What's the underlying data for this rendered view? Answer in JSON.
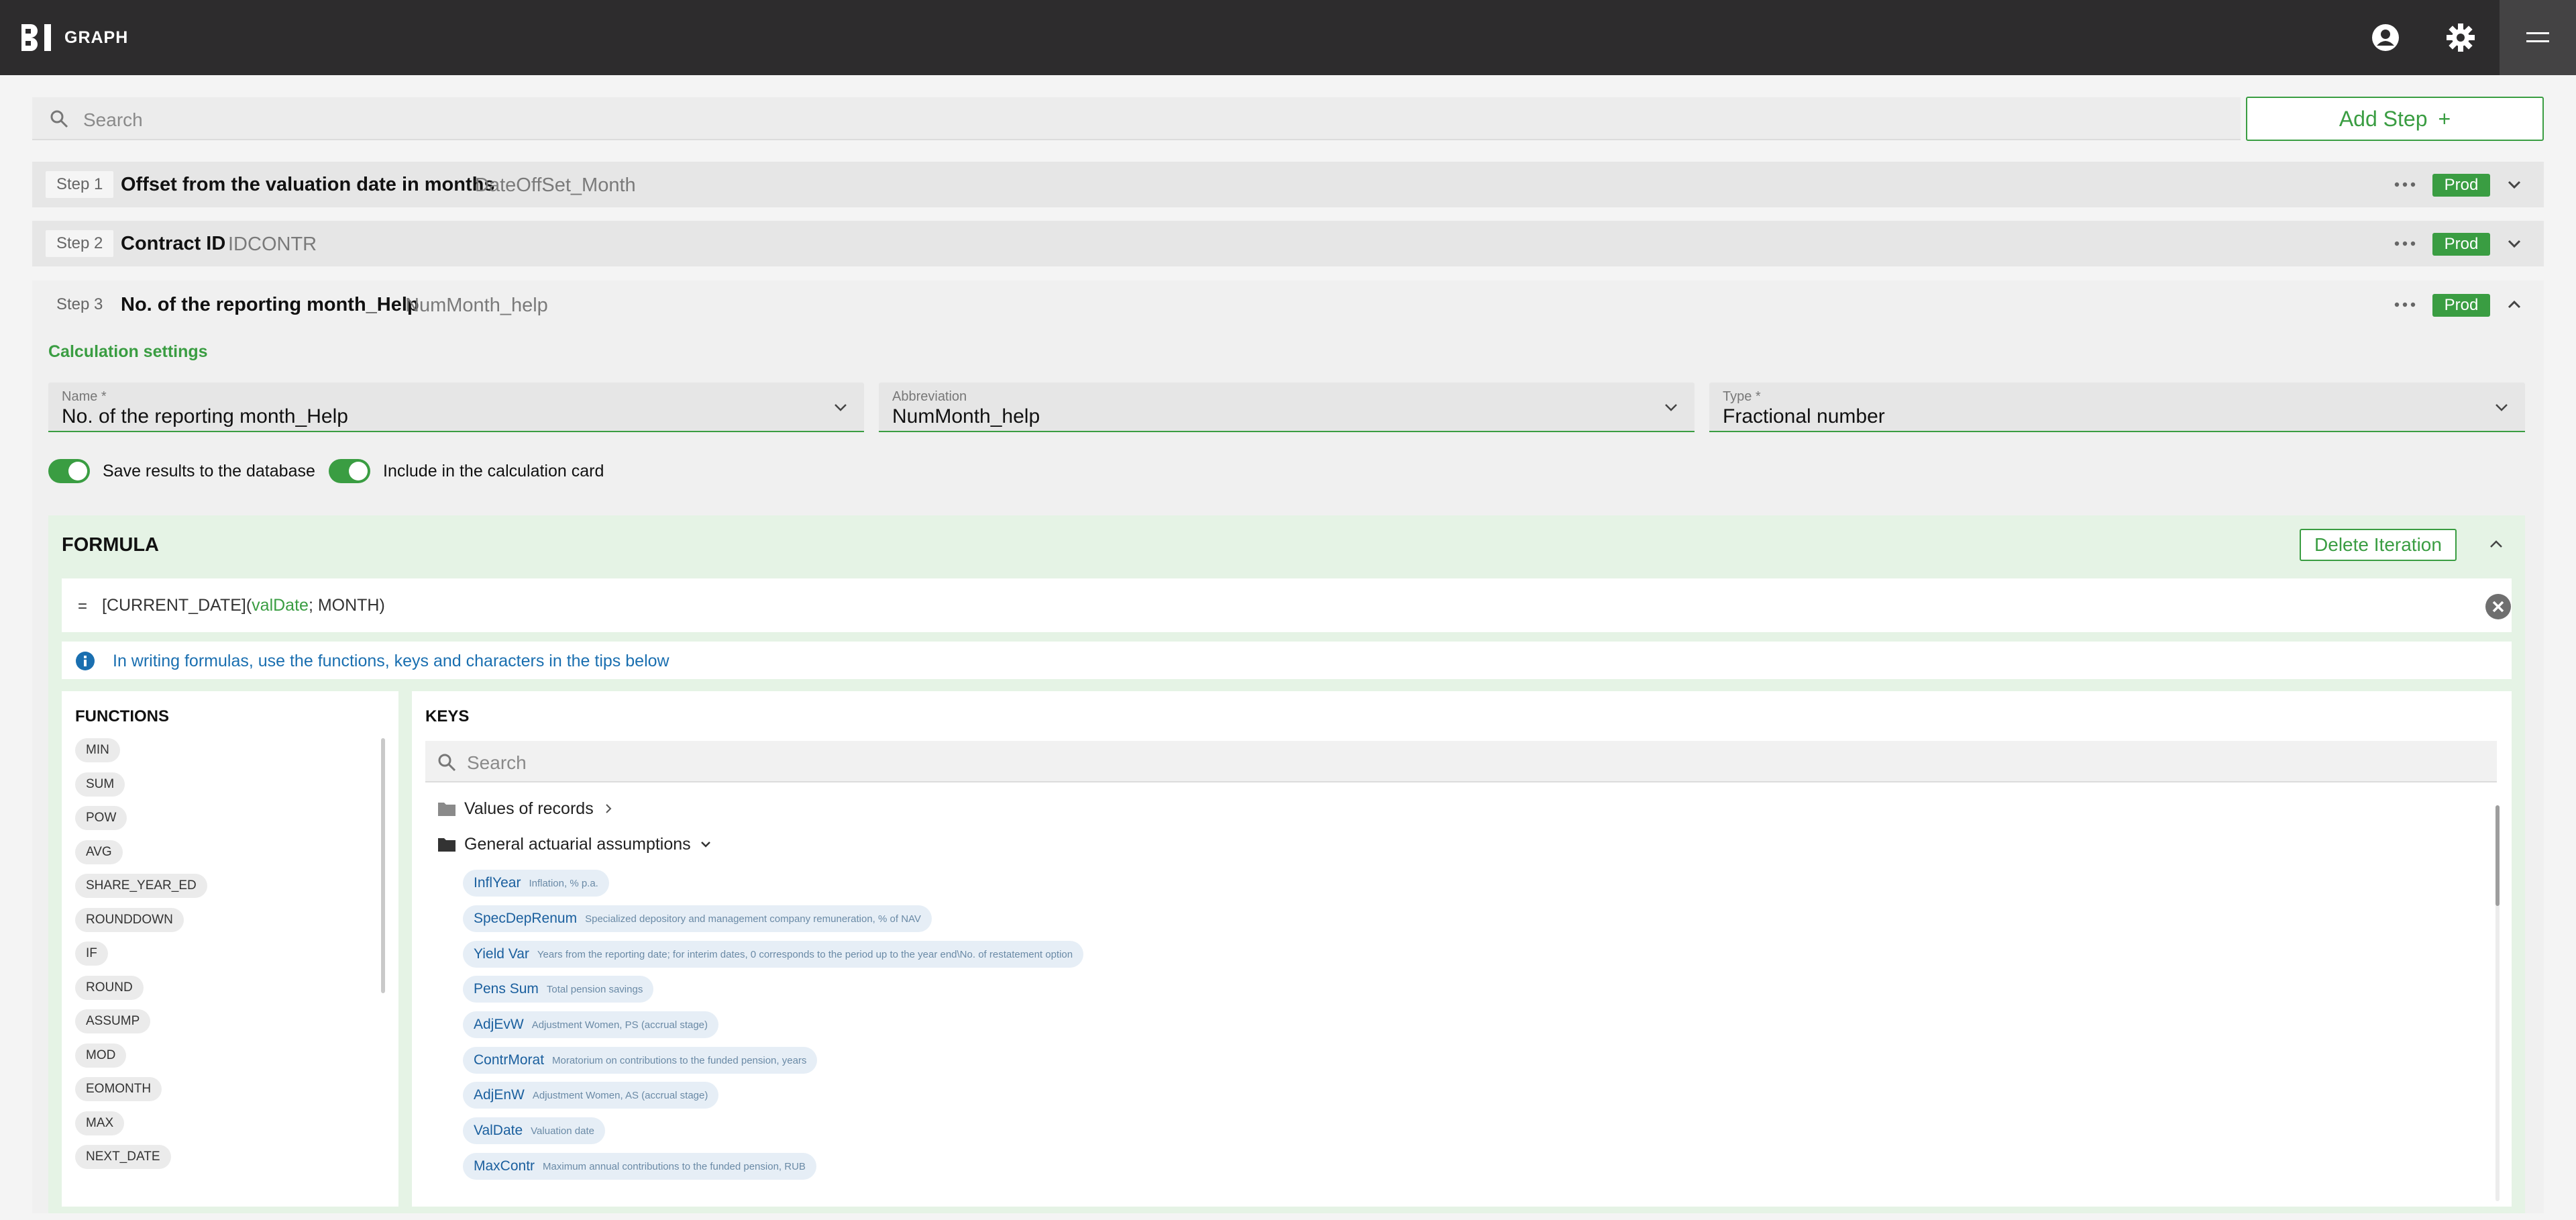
{
  "app": {
    "logo_text": "GRAPH",
    "logo_mark": "BI"
  },
  "header": {
    "icons": [
      "account-circle-icon",
      "settings-gear-icon",
      "menu-icon"
    ]
  },
  "search": {
    "placeholder": "Search"
  },
  "toolbar": {
    "add_step_label": "Add Step",
    "add_icon": "+"
  },
  "steps": [
    {
      "badge": "Step 1",
      "title": "Offset from the valuation date in months",
      "abbr": "DateOffSet_Month",
      "status": "Prod"
    },
    {
      "badge": "Step 2",
      "title": "Contract ID",
      "abbr": "IDCONTR",
      "status": "Prod"
    },
    {
      "badge": "Step 3",
      "title": "No. of the reporting month_Help",
      "abbr": "NumMonth_help",
      "status": "Prod"
    }
  ],
  "calc_settings": {
    "heading": "Calculation settings",
    "name_label": "Name *",
    "name_value": "No. of the reporting month_Help",
    "abbr_label": "Abbreviation",
    "abbr_value": "NumMonth_help",
    "type_label": "Type *",
    "type_value": "Fractional number",
    "toggle_save": "Save results to the database",
    "toggle_include": "Include in the calculation card"
  },
  "formula": {
    "title": "FORMULA",
    "delete_label": "Delete Iteration",
    "eq": "=",
    "text_prefix": "[CURRENT_DATE](",
    "text_arg": "valDate",
    "text_suffix": "; MONTH)",
    "info": "In writing formulas, use the functions, keys and characters in the tips below"
  },
  "functions": {
    "title": "FUNCTIONS",
    "items": [
      "MIN",
      "SUM",
      "POW",
      "AVG",
      "SHARE_YEAR_ED",
      "ROUNDDOWN",
      "IF",
      "ROUND",
      "ASSUMP",
      "MOD",
      "EOMONTH",
      "MAX",
      "NEXT_DATE"
    ]
  },
  "keys": {
    "title": "KEYS",
    "search_placeholder": "Search",
    "folders": [
      {
        "label": "Values of records",
        "state": "collapsed"
      },
      {
        "label": "General actuarial assumptions",
        "state": "expanded"
      }
    ],
    "items": [
      {
        "name": "InflYear",
        "desc": "Inflation, % p.a."
      },
      {
        "name": "SpecDepRenum",
        "desc": "Specialized depository and management company remuneration, % of NAV"
      },
      {
        "name": "Yield Var",
        "desc": "Years from the reporting date; for interim dates, 0 corresponds to the period up to the year end\\No. of restatement option"
      },
      {
        "name": "Pens Sum",
        "desc": "Total pension savings"
      },
      {
        "name": "AdjEvW",
        "desc": "Adjustment Women, PS (accrual stage)"
      },
      {
        "name": "ContrMorat",
        "desc": "Moratorium on contributions to the funded pension, years"
      },
      {
        "name": "AdjEnW",
        "desc": "Adjustment Women, AS (accrual stage)"
      },
      {
        "name": "ValDate",
        "desc": "Valuation date"
      },
      {
        "name": "MaxContr",
        "desc": "Maximum annual contributions to the funded pension, RUB"
      }
    ]
  },
  "colors": {
    "accent": "#3a9d42",
    "topbar": "#2d2c2d",
    "link": "#1a6fb0"
  }
}
